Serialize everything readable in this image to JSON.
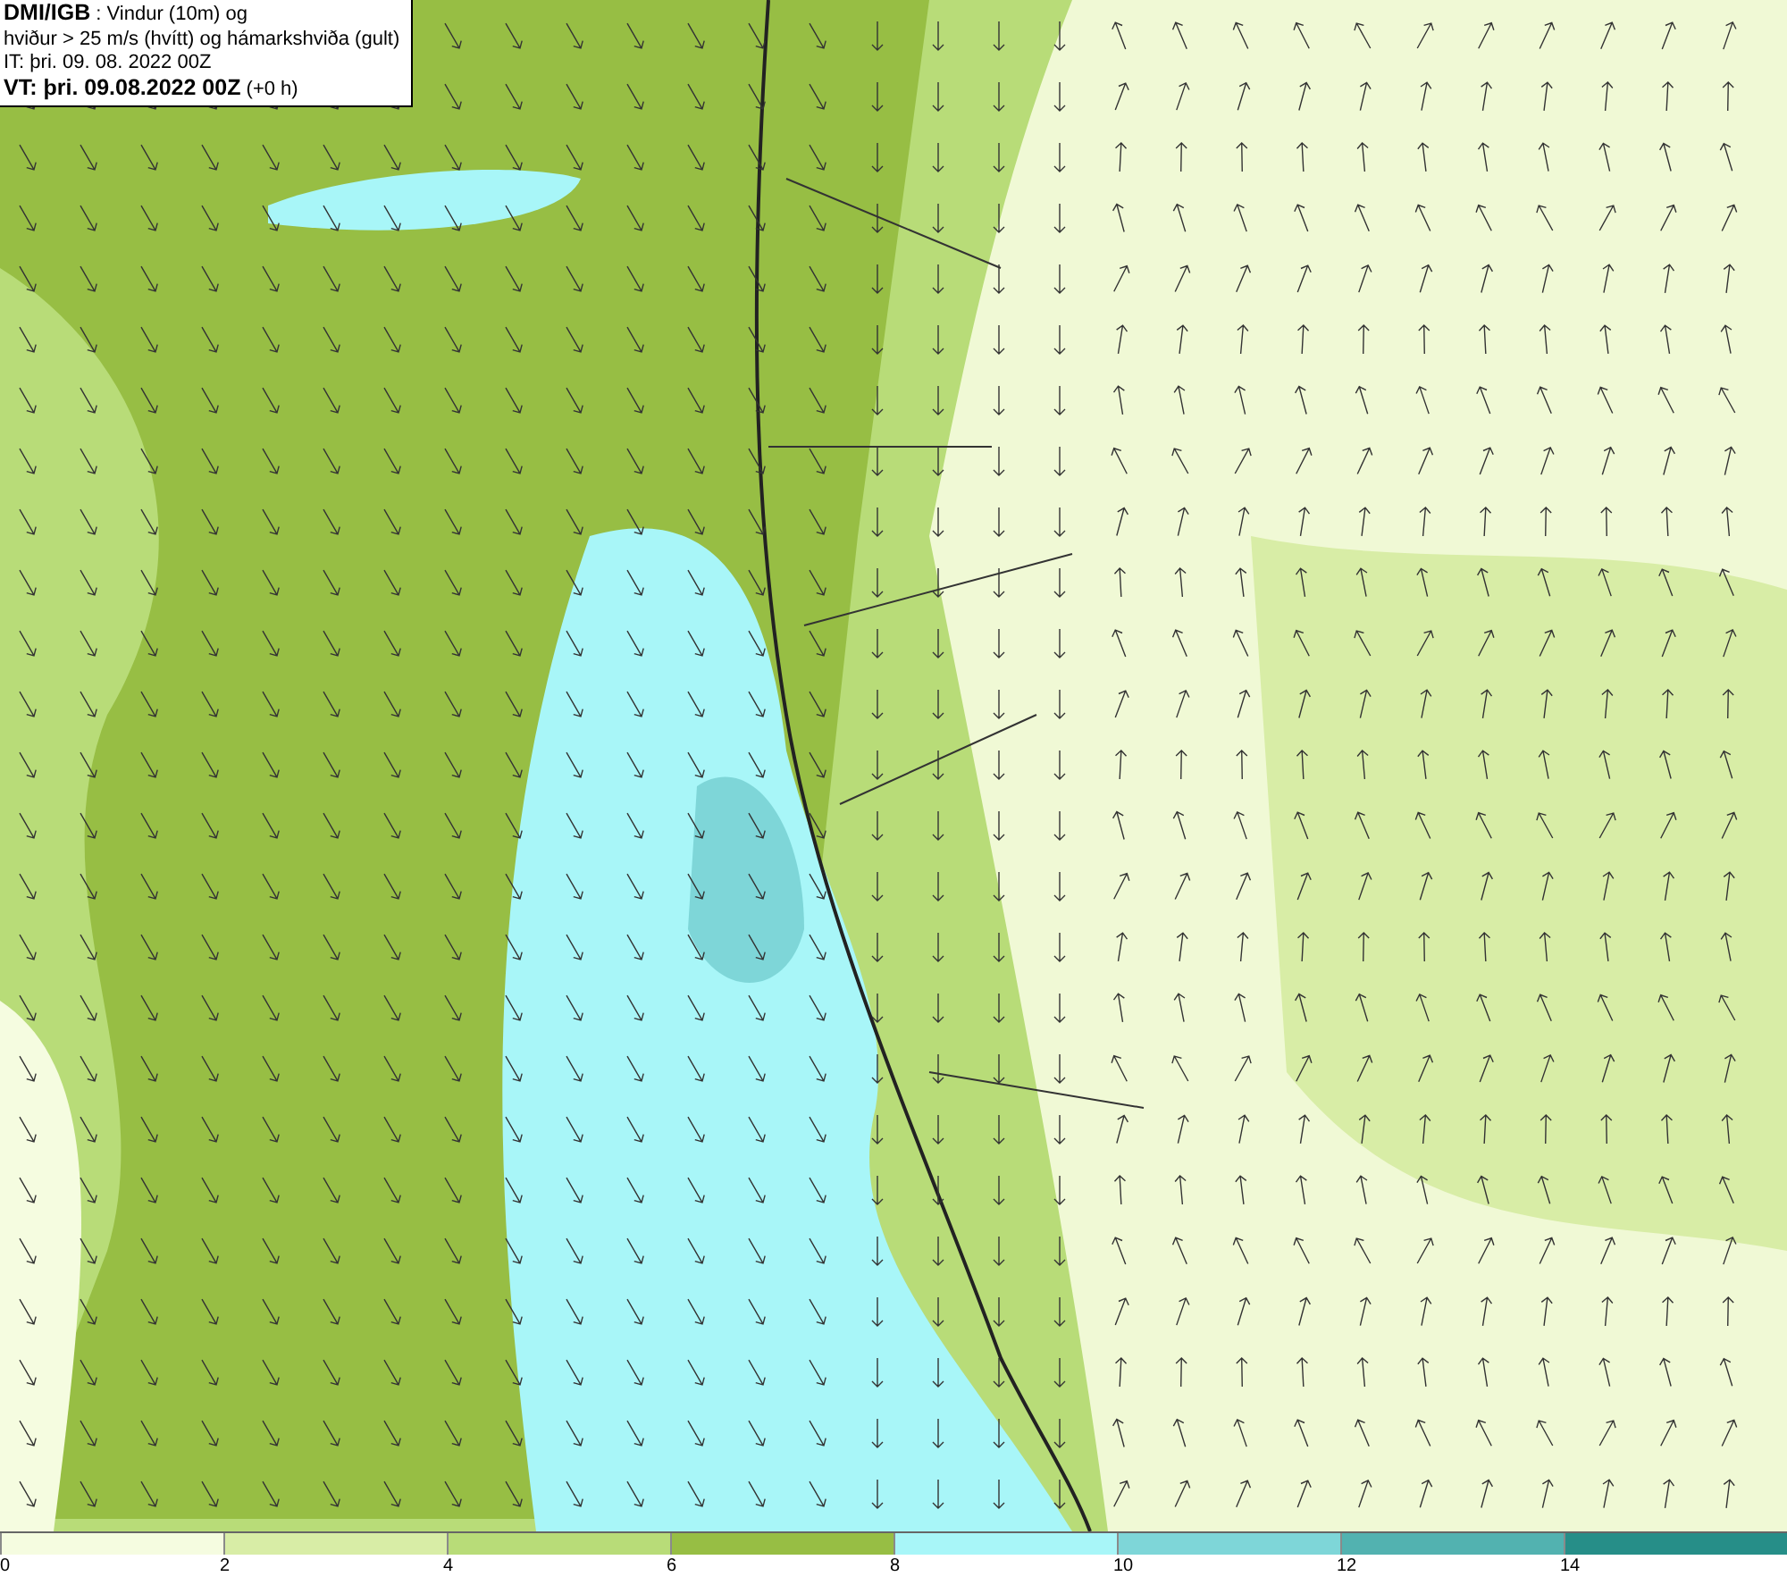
{
  "info_box": {
    "source": "DMI/IGB",
    "title_rest": " : Vindur (10m) og",
    "line_2": "hviður > 25 m/s (hvítt) og hámarkshviða (gult)",
    "issue_time": "IT: þri. 09. 08. 2022 00Z",
    "valid_time": "VT: þri. 09.08.2022 00Z",
    "offset": " (+0 h)"
  },
  "legend": [
    {
      "label": "0",
      "color": "#f5fce0"
    },
    {
      "label": "2",
      "color": "#d8eda6"
    },
    {
      "label": "4",
      "color": "#b8dc78"
    },
    {
      "label": "6",
      "color": "#97be44"
    },
    {
      "label": "8",
      "color": "#a8f6f8"
    },
    {
      "label": "10",
      "color": "#7ed6d8"
    },
    {
      "label": "12",
      "color": "#52b2b0"
    },
    {
      "label": "14",
      "color": "#268e88"
    }
  ]
}
